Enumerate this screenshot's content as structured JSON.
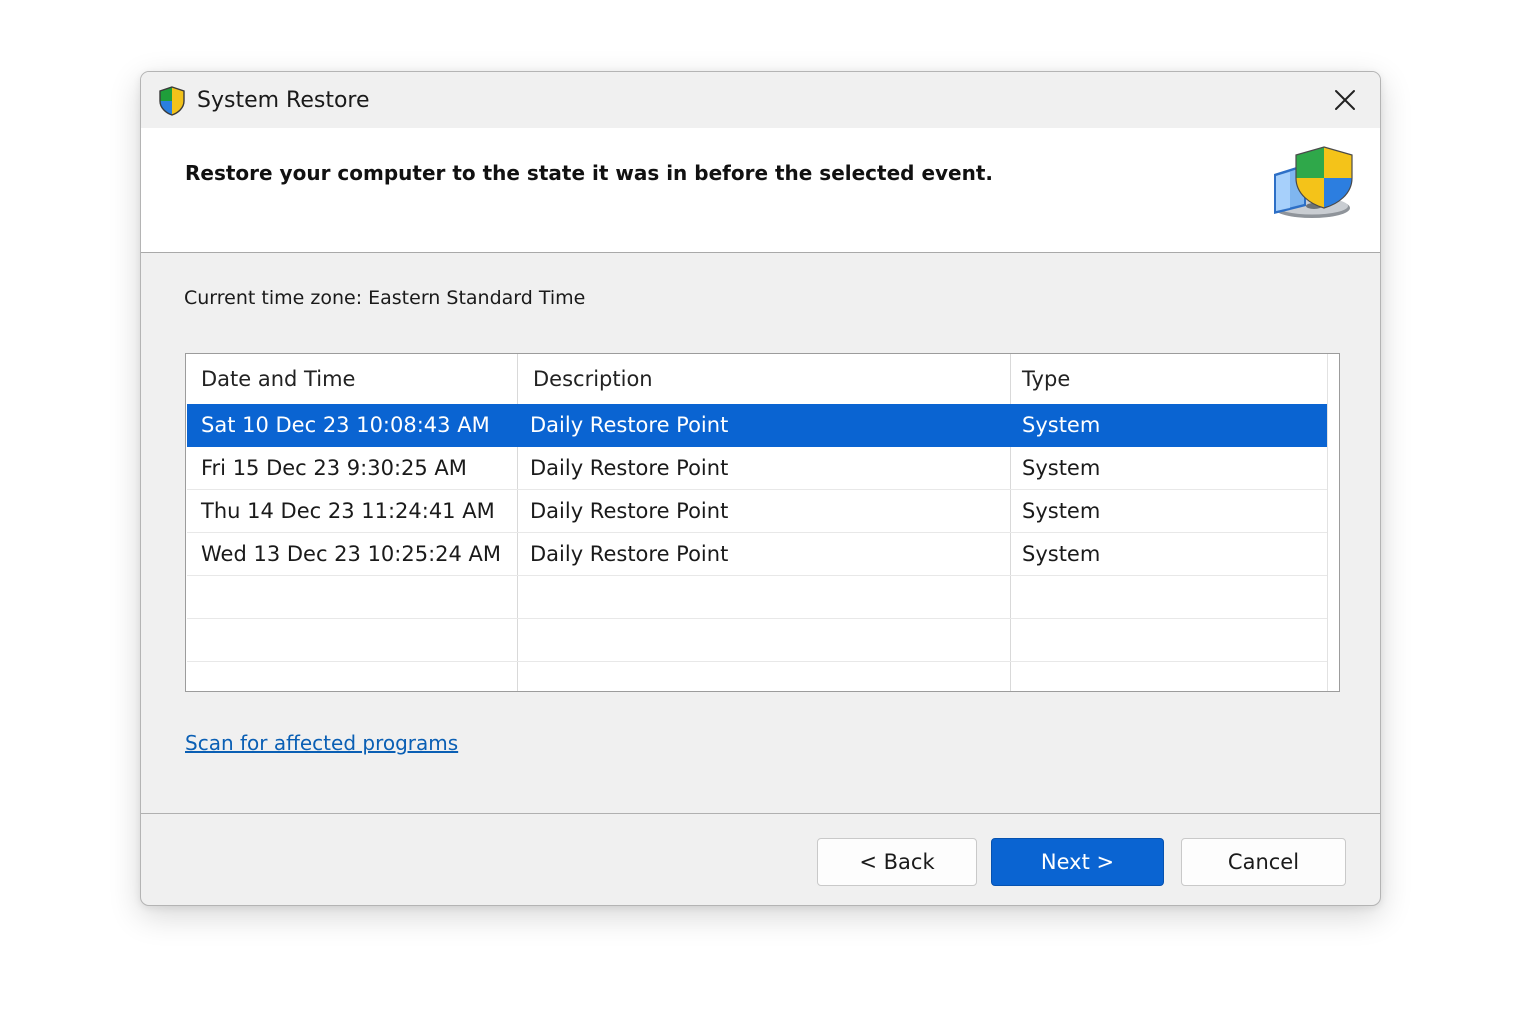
{
  "window": {
    "title": "System Restore",
    "icon": "shield-icon",
    "close_icon": "close-icon"
  },
  "header": {
    "heading": "Restore your computer to the state it was in before the selected event.",
    "icon": "system-restore-icon"
  },
  "timezone_label": "Current time zone: Eastern Standard Time",
  "table": {
    "columns": [
      "Date and Time",
      "Description",
      "Type"
    ],
    "rows": [
      {
        "date": "Sat 10 Dec 23 10:08:43 AM",
        "description": "Daily Restore Point",
        "type": "System",
        "selected": true
      },
      {
        "date": "Fri 15 Dec 23 9:30:25 AM",
        "description": "Daily Restore Point",
        "type": "System",
        "selected": false
      },
      {
        "date": "Thu 14 Dec 23 11:24:41 AM",
        "description": "Daily Restore Point",
        "type": "System",
        "selected": false
      },
      {
        "date": "Wed 13 Dec 23 10:25:24 AM",
        "description": "Daily Restore Point",
        "type": "System",
        "selected": false
      }
    ]
  },
  "scan_link": "Scan for affected programs",
  "buttons": {
    "back": "< Back",
    "next": "Next >",
    "cancel": "Cancel"
  },
  "colors": {
    "accent": "#0a64d2",
    "link": "#0a5fb4",
    "dialog_bg": "#f0f0f0"
  }
}
